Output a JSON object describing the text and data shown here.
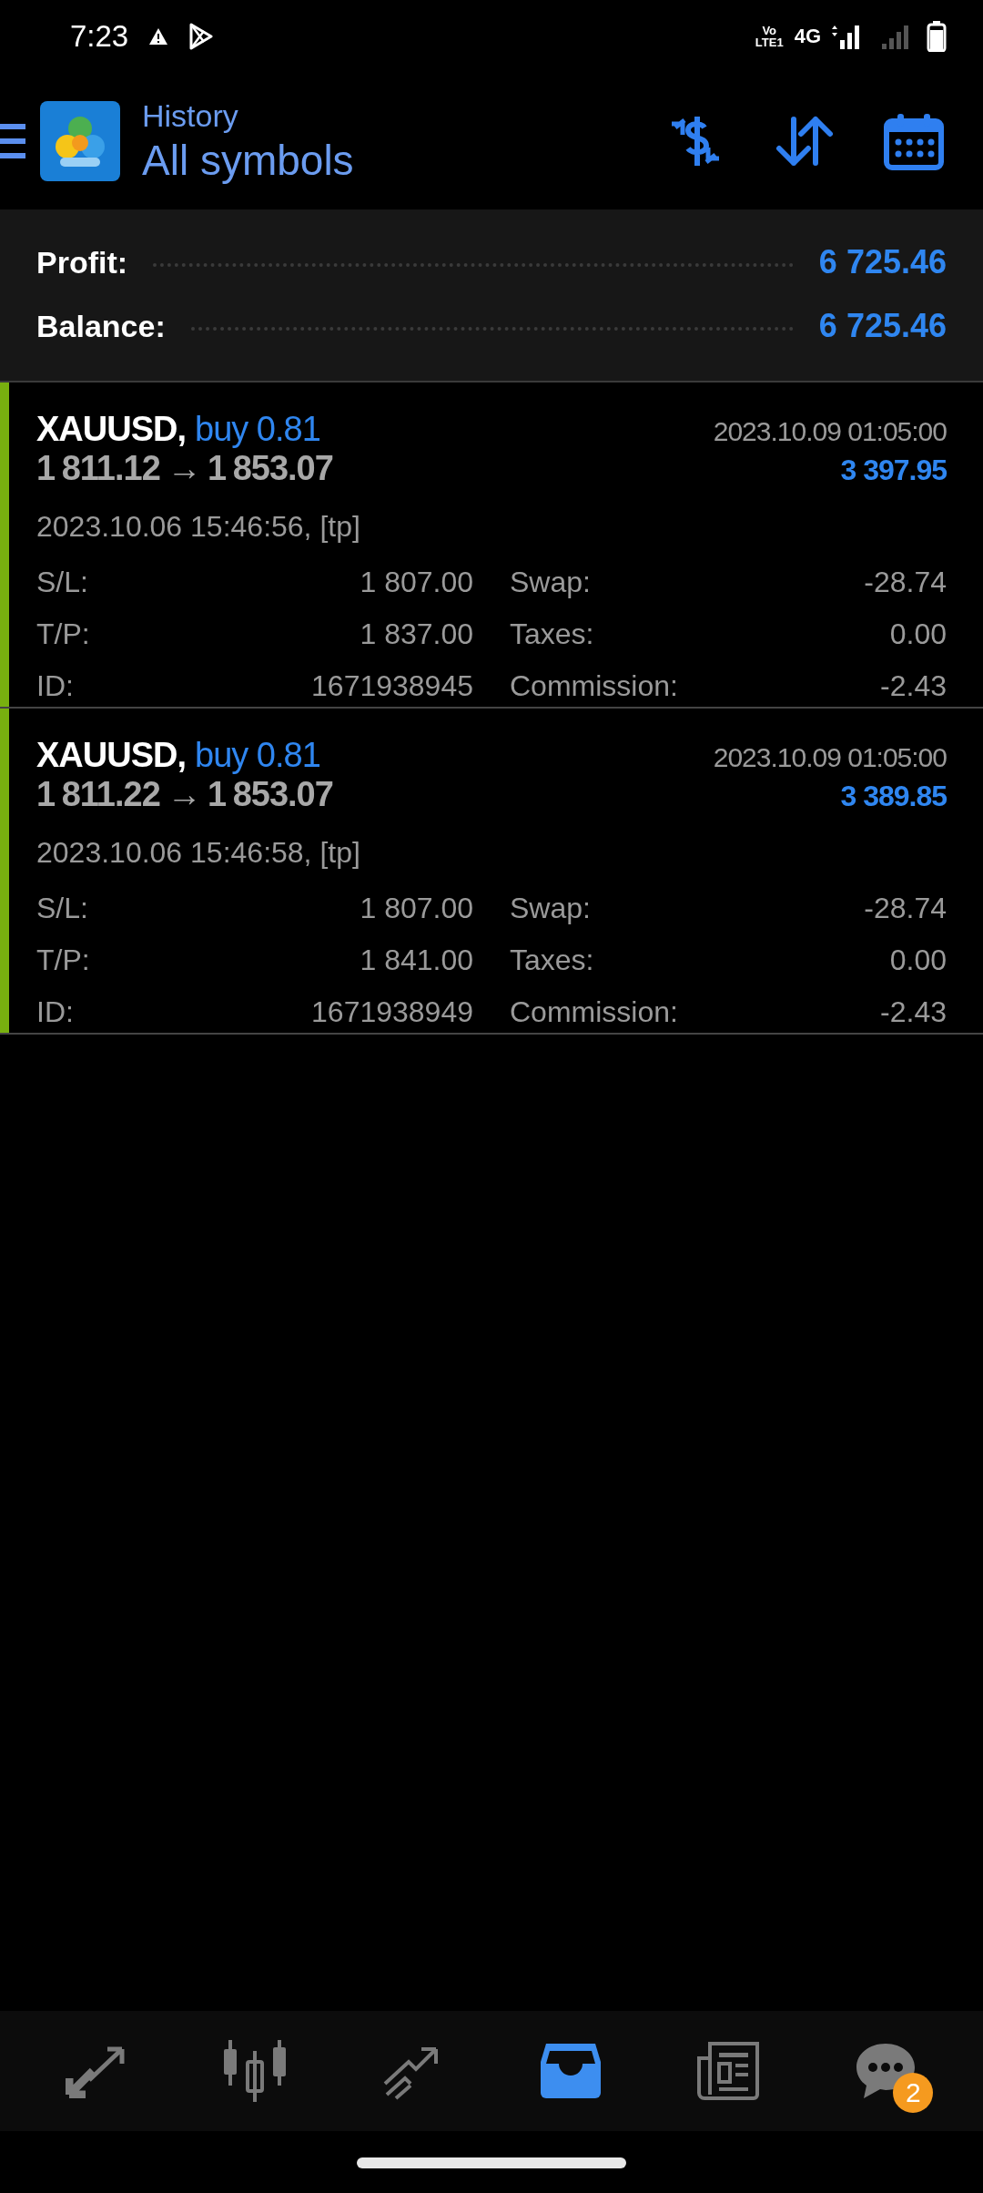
{
  "status_bar": {
    "time": "7:23",
    "volte": [
      "Vo",
      "LTE1"
    ],
    "network": "4G"
  },
  "header": {
    "title": "History",
    "subtitle": "All symbols"
  },
  "summary": [
    {
      "label": "Profit:",
      "value": "6 725.46"
    },
    {
      "label": "Balance:",
      "value": "6 725.46"
    }
  ],
  "deals": [
    {
      "kind": "buy",
      "symbol": "XAUUSD,",
      "side": "buy 0.81",
      "open_price": "1 811.12",
      "arrow": "→",
      "close_price": "1 853.07",
      "close_time": "2023.10.09 01:05:00",
      "profit": "3 397.95",
      "open_time": "2023.10.06 15:46:56, [tp]",
      "fields": [
        {
          "label": "S/L:",
          "value": "1 807.00"
        },
        {
          "label": "Swap:",
          "value": "-28.74"
        },
        {
          "label": "T/P:",
          "value": "1 837.00"
        },
        {
          "label": "Taxes:",
          "value": "0.00"
        },
        {
          "label": "ID:",
          "value": "1671938945"
        },
        {
          "label": "Commission:",
          "value": "-2.43"
        }
      ]
    },
    {
      "kind": "buy",
      "symbol": "XAUUSD,",
      "side": "buy 0.81",
      "open_price": "1 811.22",
      "arrow": "→",
      "close_price": "1 853.07",
      "close_time": "2023.10.09 01:05:00",
      "profit": "3 389.85",
      "open_time": "2023.10.06 15:46:58, [tp]",
      "fields": [
        {
          "label": "S/L:",
          "value": "1 807.00"
        },
        {
          "label": "Swap:",
          "value": "-28.74"
        },
        {
          "label": "T/P:",
          "value": "1 841.00"
        },
        {
          "label": "Taxes:",
          "value": "0.00"
        },
        {
          "label": "ID:",
          "value": "1671938949"
        },
        {
          "label": "Commission:",
          "value": "-2.43"
        }
      ]
    }
  ],
  "bottom_nav": [
    {
      "kind": "quotes",
      "selected": false
    },
    {
      "kind": "chart",
      "selected": false
    },
    {
      "kind": "trade",
      "selected": false
    },
    {
      "kind": "history",
      "selected": true
    },
    {
      "kind": "news",
      "selected": false
    },
    {
      "kind": "chat",
      "selected": false,
      "badge": "2"
    }
  ]
}
